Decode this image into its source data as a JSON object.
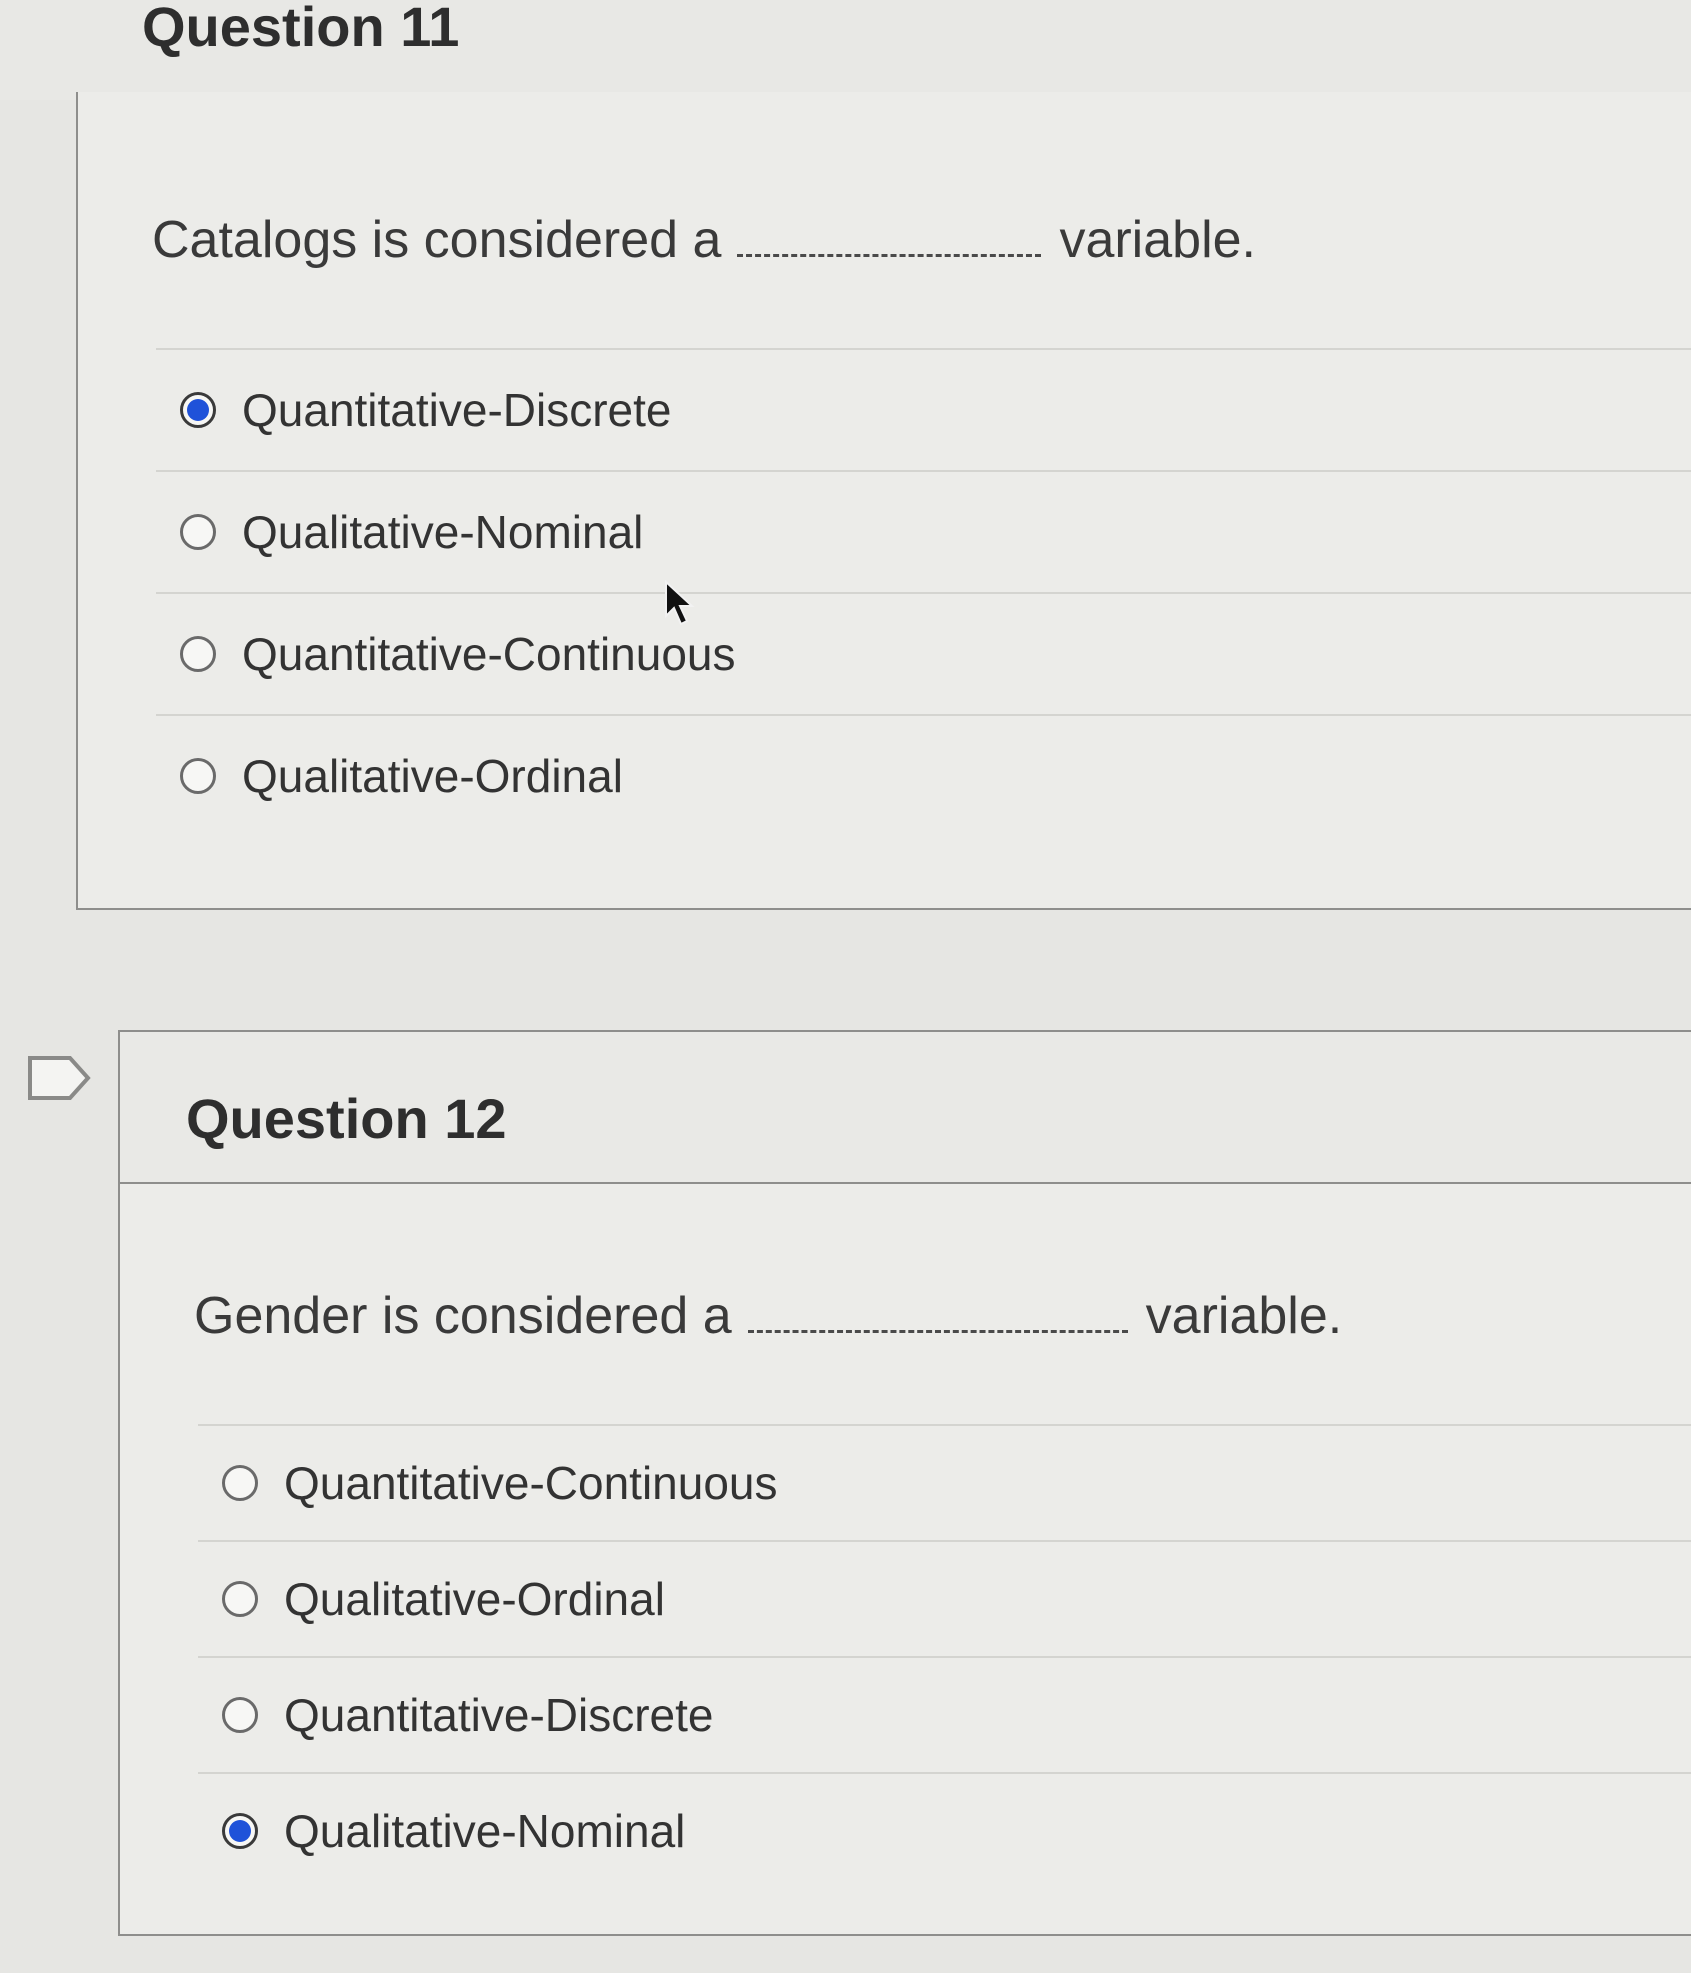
{
  "q11": {
    "title": "Question 11",
    "prompt_before": "Catalogs is considered a",
    "prompt_after": "variable.",
    "answers": [
      {
        "label": "Quantitative-Discrete",
        "selected": true
      },
      {
        "label": "Qualitative-Nominal",
        "selected": false
      },
      {
        "label": "Quantitative-Continuous",
        "selected": false
      },
      {
        "label": "Qualitative-Ordinal",
        "selected": false
      }
    ]
  },
  "q12": {
    "title": "Question 12",
    "prompt_before": "Gender is considered a",
    "prompt_after": "variable.",
    "answers": [
      {
        "label": "Quantitative-Continuous",
        "selected": false
      },
      {
        "label": "Qualitative-Ordinal",
        "selected": false
      },
      {
        "label": "Quantitative-Discrete",
        "selected": false
      },
      {
        "label": "Qualitative-Nominal",
        "selected": true
      }
    ]
  },
  "icons": {
    "flag": "bookmark-flag-icon",
    "cursor": "mouse-pointer-icon"
  },
  "colors": {
    "selected_radio": "#1f52d9",
    "page_background": "#e6e6e3"
  }
}
